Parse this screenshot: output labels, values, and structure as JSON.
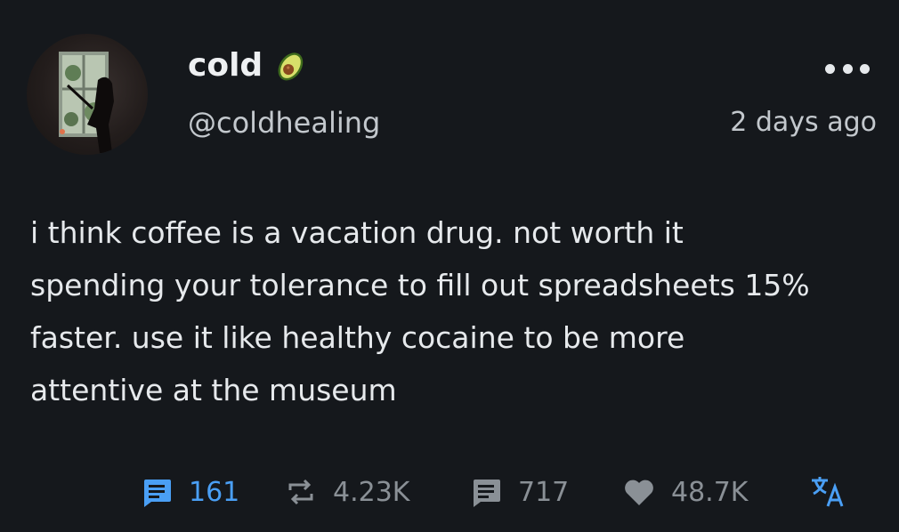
{
  "post": {
    "author": {
      "display_name": "cold",
      "handle": "@coldhealing",
      "badge_icon": "avocado-icon",
      "avatar_icon": "avatar-window-silhouette"
    },
    "timestamp": "2 days ago",
    "text": "i think coffee is a vacation drug. not worth it\nspending your tolerance to fill out spreadsheets 15%\nfaster. use it like healthy cocaine to be more\nattentive at the museum"
  },
  "actions": {
    "comments": {
      "icon": "comment-icon",
      "count": "161",
      "color": "#4a9ff5"
    },
    "reposts": {
      "icon": "repost-icon",
      "count": "4.23K"
    },
    "quotes": {
      "icon": "quote-icon",
      "count": "717"
    },
    "likes": {
      "icon": "heart-icon",
      "count": "48.7K"
    },
    "translate": {
      "icon": "translate-icon"
    }
  },
  "colors": {
    "background": "#15181c",
    "text": "#e6e9ec",
    "muted": "#8a9096",
    "accent": "#4a9ff5"
  }
}
